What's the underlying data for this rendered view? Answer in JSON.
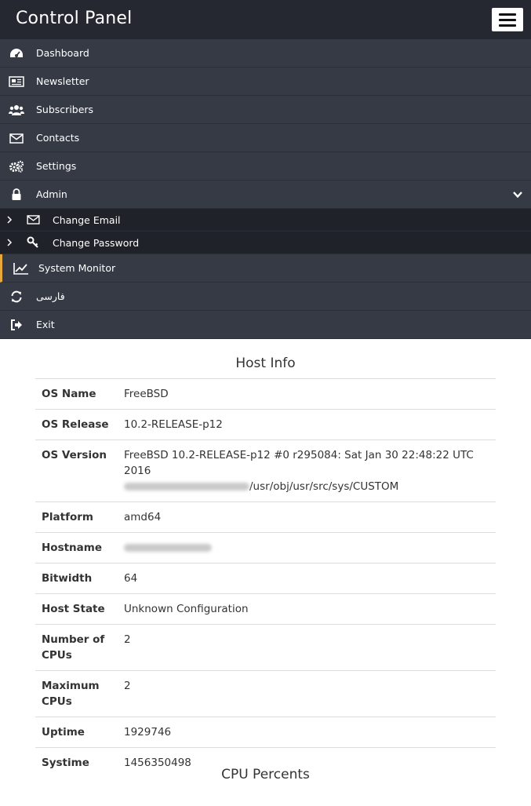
{
  "header": {
    "title": "Control Panel"
  },
  "nav": {
    "items": [
      {
        "label": "Dashboard",
        "icon": "dashboard-icon"
      },
      {
        "label": "Newsletter",
        "icon": "newspaper-icon"
      },
      {
        "label": "Subscribers",
        "icon": "users-icon"
      },
      {
        "label": "Contacts",
        "icon": "envelope-icon"
      },
      {
        "label": "Settings",
        "icon": "gears-icon"
      },
      {
        "label": "Admin",
        "icon": "lock-icon"
      }
    ],
    "admin_sub": [
      {
        "label": "Change Email",
        "icon": "envelope-icon"
      },
      {
        "label": "Change Password",
        "icon": "key-icon"
      }
    ],
    "after": [
      {
        "label": "System Monitor",
        "icon": "line-chart-icon"
      },
      {
        "label": "فارسی",
        "icon": "refresh-icon"
      },
      {
        "label": "Exit",
        "icon": "sign-out-icon"
      }
    ]
  },
  "host_info": {
    "title": "Host Info",
    "rows": [
      {
        "key": "OS Name",
        "value": "FreeBSD"
      },
      {
        "key": "OS Release",
        "value": "10.2-RELEASE-p12"
      },
      {
        "key": "OS Version",
        "value": "FreeBSD 10.2-RELEASE-p12 #0 r295084: Sat Jan 30 22:48:22 UTC 2016",
        "value2": "/usr/obj/usr/src/sys/CUSTOM"
      },
      {
        "key": "Platform",
        "value": "amd64"
      },
      {
        "key": "Hostname",
        "value": ""
      },
      {
        "key": "Bitwidth",
        "value": "64"
      },
      {
        "key": "Host State",
        "value": "Unknown Configuration"
      },
      {
        "key": "Number of CPUs",
        "value": "2"
      },
      {
        "key": "Maximum CPUs",
        "value": "2"
      },
      {
        "key": "Uptime",
        "value": "1929746"
      },
      {
        "key": "Systime",
        "value": "1456350498"
      }
    ]
  },
  "cpu_percents": {
    "title": "CPU Percents"
  },
  "colors": {
    "topbar": "#252830",
    "nav": "#353a45",
    "subnav": "#1f2228",
    "active_accent": "#e8a93a"
  }
}
